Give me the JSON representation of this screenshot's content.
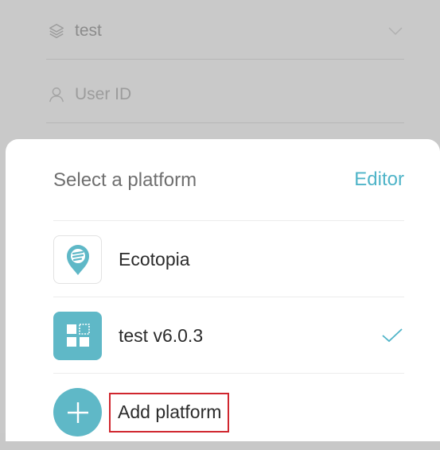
{
  "background_form": {
    "group_field": {
      "value": "test",
      "icon": "layers-icon",
      "dropdown_icon": "chevron-down-icon"
    },
    "user_id_field": {
      "placeholder": "User ID",
      "icon": "user-icon"
    }
  },
  "sheet": {
    "title": "Select a platform",
    "editor_label": "Editor",
    "platforms": [
      {
        "name": "Ecotopia",
        "icon": "ecotopia-logo-icon",
        "selected": false
      },
      {
        "name": "test v6.0.3",
        "icon": "grid-app-icon",
        "selected": true
      }
    ],
    "add_platform_label": "Add platform",
    "add_icon": "plus-icon"
  },
  "colors": {
    "accent": "#4fb4c8",
    "tile": "#5fb8c7",
    "highlight_border": "#d0262e",
    "overlay": "#c9c9c9"
  }
}
